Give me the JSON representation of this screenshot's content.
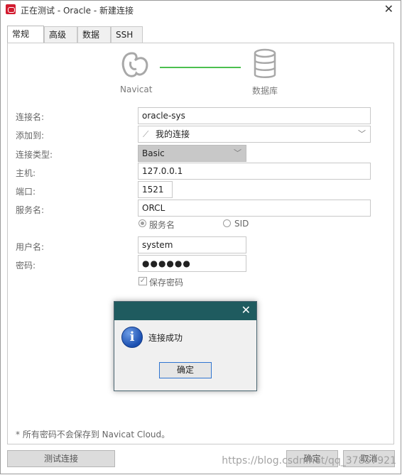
{
  "window": {
    "title": "正在测试 - Oracle - 新建连接",
    "close": "✕"
  },
  "tabs": [
    "常规",
    "高级",
    "数据库",
    "SSH"
  ],
  "header": {
    "left_label": "Navicat",
    "right_label": "数据库",
    "line_color": "#4cbf4f"
  },
  "form": {
    "conn_name": {
      "label": "连接名:",
      "value": "oracle-sys"
    },
    "add_to": {
      "label": "添加到:",
      "value": "我的连接"
    },
    "conn_type": {
      "label": "连接类型:",
      "value": "Basic"
    },
    "host": {
      "label": "主机:",
      "value": "127.0.0.1"
    },
    "port": {
      "label": "端口:",
      "value": "1521"
    },
    "service": {
      "label": "服务名:",
      "value": "ORCL"
    },
    "radio_service": "服务名",
    "radio_sid": "SID",
    "username": {
      "label": "用户名:",
      "value": "system"
    },
    "password": {
      "label": "密码:",
      "value": "●●●●●●"
    },
    "save_password": "保存密码"
  },
  "note": "* 所有密码不会保存到 Navicat Cloud。",
  "buttons": {
    "test": "测试连接",
    "ok": "确定",
    "cancel": "取消"
  },
  "dialog": {
    "message": "连接成功",
    "ok": "确定",
    "close": "✕"
  },
  "watermark": "https://blog.csdn.net/qq_37857921",
  "colors": {
    "dialog_titlebar": "#1f5b5f",
    "app_icon": "#d21b2f"
  }
}
